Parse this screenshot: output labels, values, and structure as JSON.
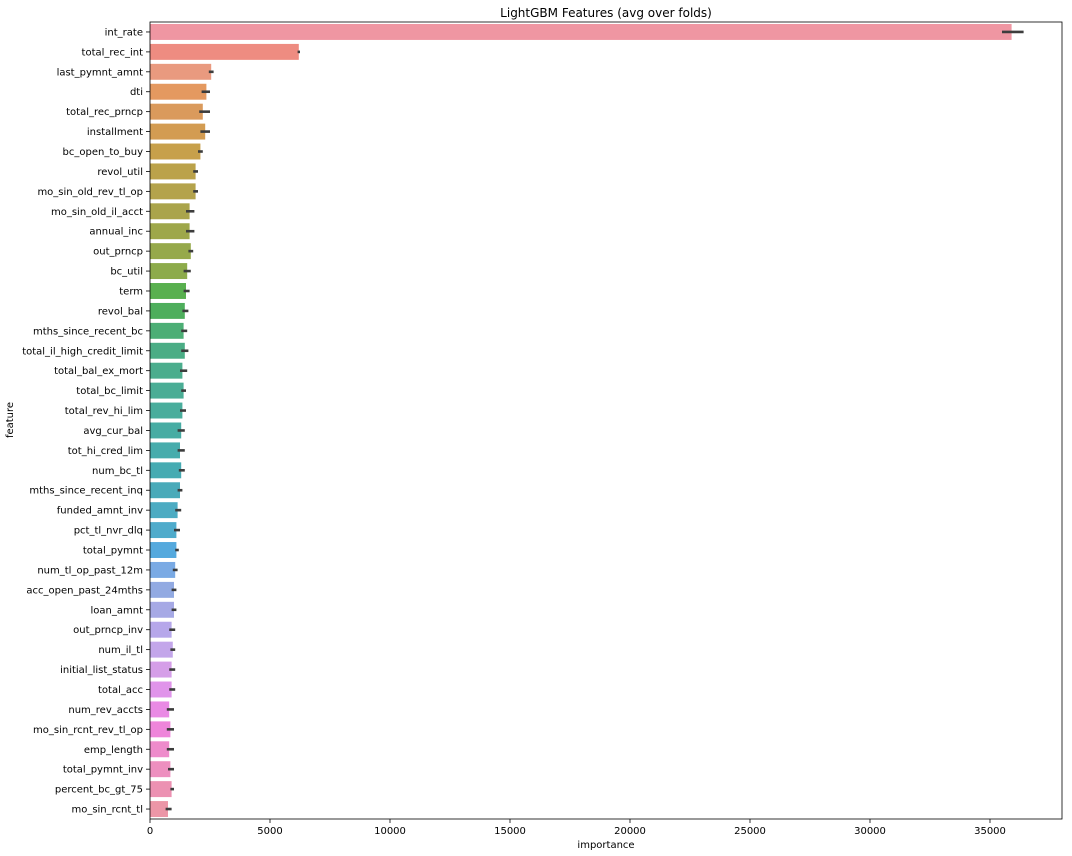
{
  "chart_data": {
    "type": "bar",
    "orientation": "horizontal",
    "title": "LightGBM Features (avg over folds)",
    "xlabel": "importance",
    "ylabel": "feature",
    "xlim": [
      0,
      38000
    ],
    "xticks": [
      0,
      5000,
      10000,
      15000,
      20000,
      25000,
      30000,
      35000
    ],
    "grid": false,
    "categories": [
      "int_rate",
      "total_rec_int",
      "last_pymnt_amnt",
      "dti",
      "total_rec_prncp",
      "installment",
      "bc_open_to_buy",
      "revol_util",
      "mo_sin_old_rev_tl_op",
      "mo_sin_old_il_acct",
      "annual_inc",
      "out_prncp",
      "bc_util",
      "term",
      "revol_bal",
      "mths_since_recent_bc",
      "total_il_high_credit_limit",
      "total_bal_ex_mort",
      "total_bc_limit",
      "total_rev_hi_lim",
      "avg_cur_bal",
      "tot_hi_cred_lim",
      "num_bc_tl",
      "mths_since_recent_inq",
      "funded_amnt_inv",
      "pct_tl_nvr_dlq",
      "total_pymnt",
      "num_tl_op_past_12m",
      "acc_open_past_24mths",
      "loan_amnt",
      "out_prncp_inv",
      "num_il_tl",
      "initial_list_status",
      "total_acc",
      "num_rev_accts",
      "mo_sin_rcnt_rev_tl_op",
      "emp_length",
      "total_pymnt_inv",
      "percent_bc_gt_75",
      "mo_sin_rcnt_tl"
    ],
    "values": [
      35900,
      6200,
      2550,
      2350,
      2200,
      2300,
      2100,
      1900,
      1900,
      1650,
      1650,
      1700,
      1550,
      1500,
      1450,
      1400,
      1450,
      1350,
      1400,
      1350,
      1300,
      1250,
      1300,
      1250,
      1150,
      1100,
      1100,
      1050,
      1000,
      1000,
      900,
      950,
      900,
      900,
      800,
      850,
      800,
      850,
      900,
      750
    ],
    "error_low": [
      35500,
      6150,
      2450,
      2150,
      2050,
      2100,
      2000,
      1800,
      1800,
      1500,
      1500,
      1600,
      1400,
      1400,
      1350,
      1300,
      1300,
      1250,
      1300,
      1250,
      1150,
      1150,
      1200,
      1150,
      1050,
      1000,
      1050,
      950,
      900,
      900,
      800,
      850,
      800,
      800,
      700,
      700,
      700,
      750,
      850,
      650
    ],
    "error_high": [
      36400,
      6250,
      2650,
      2500,
      2500,
      2500,
      2200,
      2000,
      2000,
      1850,
      1850,
      1800,
      1700,
      1650,
      1600,
      1550,
      1600,
      1550,
      1500,
      1500,
      1450,
      1450,
      1450,
      1350,
      1300,
      1250,
      1200,
      1150,
      1100,
      1100,
      1050,
      1050,
      1050,
      1050,
      1000,
      1000,
      1000,
      1000,
      1000,
      900
    ],
    "colors": [
      "#ef96a2",
      "#ee8c81",
      "#e99a7f",
      "#e49960",
      "#da9a5c",
      "#d39c52",
      "#c7a04b",
      "#bba24a",
      "#b4a34c",
      "#aaa44b",
      "#9ea74a",
      "#96a94b",
      "#8dab4b",
      "#59b04f",
      "#4eae5c",
      "#4cae75",
      "#4bad85",
      "#4bad8d",
      "#4aad95",
      "#49ad9c",
      "#47aca3",
      "#47acac",
      "#46abb2",
      "#49aab9",
      "#4cabc2",
      "#4fabcb",
      "#55a9dd",
      "#7aaae4",
      "#92aae2",
      "#a6a9e5",
      "#b6a7ea",
      "#c3a6ea",
      "#d59ee8",
      "#e094ea",
      "#e98ae4",
      "#ee85da",
      "#ee8bcb",
      "#ed8fbf",
      "#ec91b2",
      "#ec96a7"
    ]
  }
}
